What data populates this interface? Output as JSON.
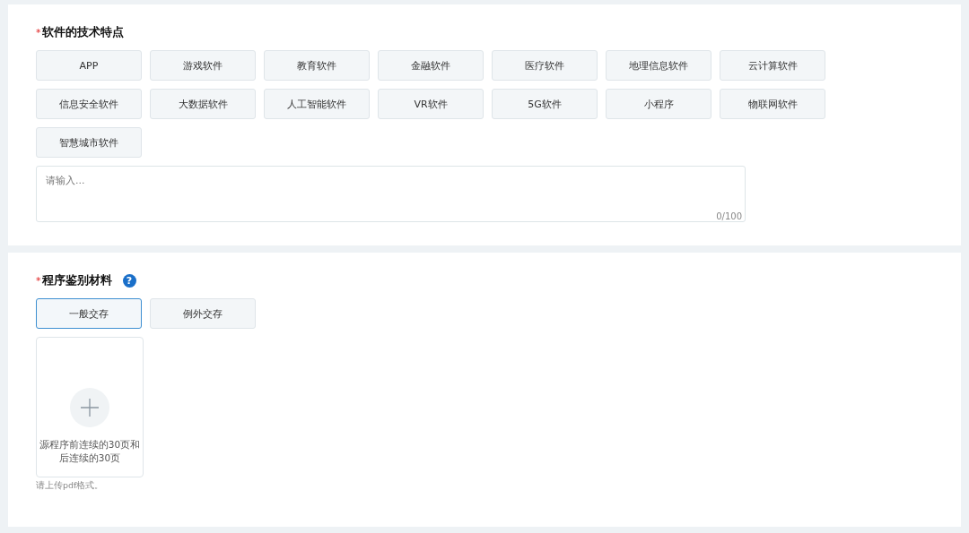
{
  "sections": [
    {
      "kind": "tags",
      "required_mark": "*",
      "title": "软件的技术特点",
      "options": [
        {
          "label": "APP",
          "selected": false
        },
        {
          "label": "游戏软件",
          "selected": false
        },
        {
          "label": "教育软件",
          "selected": false
        },
        {
          "label": "金融软件",
          "selected": false
        },
        {
          "label": "医疗软件",
          "selected": false
        },
        {
          "label": "地理信息软件",
          "selected": false
        },
        {
          "label": "云计算软件",
          "selected": false
        },
        {
          "label": "信息安全软件",
          "selected": false
        },
        {
          "label": "大数据软件",
          "selected": false
        },
        {
          "label": "人工智能软件",
          "selected": false
        },
        {
          "label": "VR软件",
          "selected": false
        },
        {
          "label": "5G软件",
          "selected": false
        },
        {
          "label": "小程序",
          "selected": false
        },
        {
          "label": "物联网软件",
          "selected": false
        },
        {
          "label": "智慧城市软件",
          "selected": false
        }
      ],
      "textarea": {
        "placeholder": "请输入...",
        "counter": "0/100"
      }
    },
    {
      "kind": "upload",
      "required_mark": "*",
      "title": "程序鉴别材料",
      "help": "?",
      "options": [
        {
          "label": "一般交存",
          "selected": true
        },
        {
          "label": "例外交存",
          "selected": false
        }
      ],
      "upload": {
        "caption": "源程序前连续的30页和后连续的30页",
        "hint": "请上传pdf格式。"
      }
    }
  ]
}
